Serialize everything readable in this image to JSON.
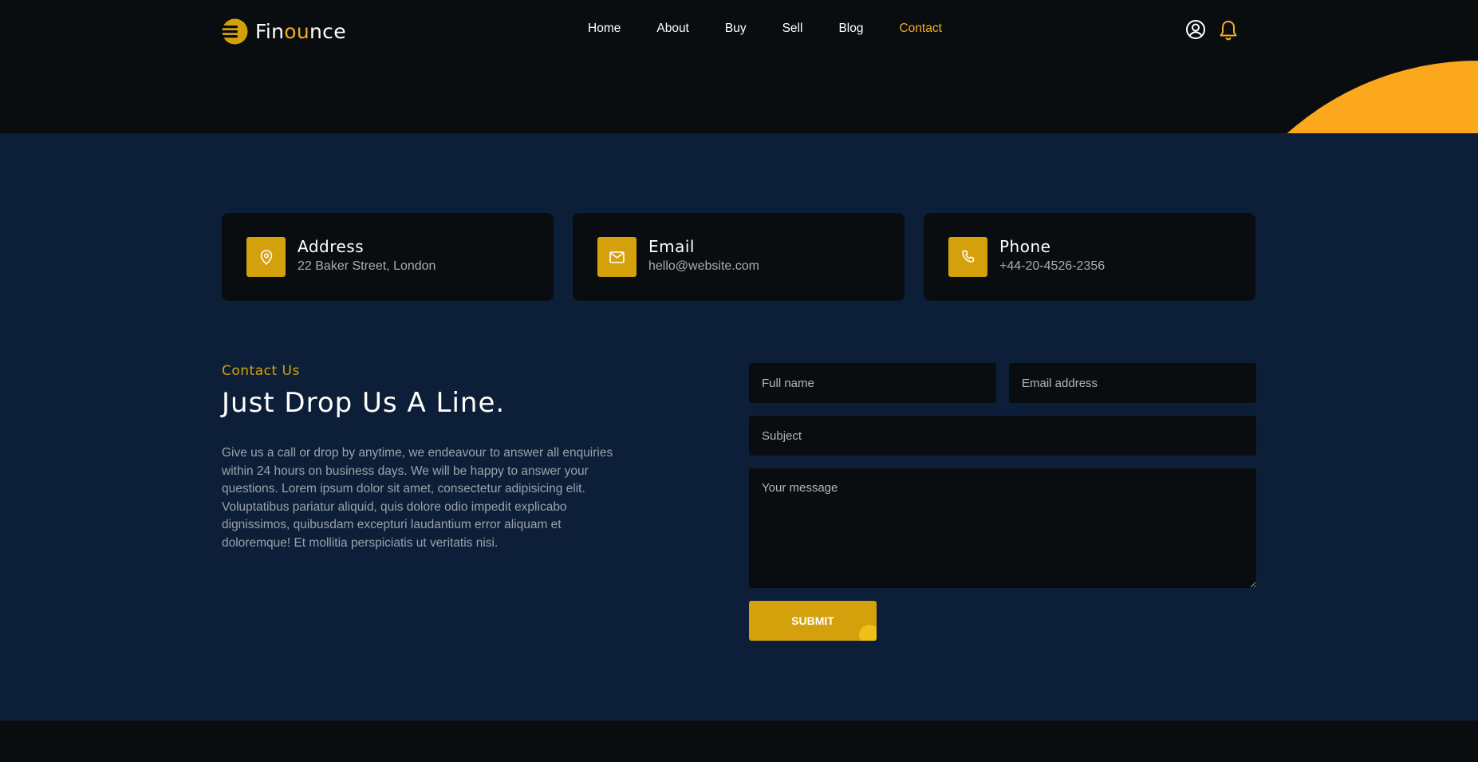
{
  "brand": {
    "name_part1": "Fin",
    "name_accent": "ou",
    "name_part2": "nce",
    "accent_color": "#f3ad1c"
  },
  "nav": {
    "items": [
      {
        "label": "Home",
        "active": false
      },
      {
        "label": "About",
        "active": false
      },
      {
        "label": "Buy",
        "active": false
      },
      {
        "label": "Sell",
        "active": false
      },
      {
        "label": "Blog",
        "active": false
      },
      {
        "label": "Contact",
        "active": true
      }
    ]
  },
  "header_icons": [
    "user-circle-icon",
    "bell-icon"
  ],
  "contact_cards": [
    {
      "icon": "map-pin-icon",
      "title": "Address",
      "value": "22 Baker Street, London"
    },
    {
      "icon": "envelope-icon",
      "title": "Email",
      "value": "hello@website.com"
    },
    {
      "icon": "phone-icon",
      "title": "Phone",
      "value": "+44-20-4526-2356"
    }
  ],
  "section": {
    "eyebrow": "Contact Us",
    "headline": "Just Drop Us A Line.",
    "paragraph": "Give us a call or drop by anytime, we endeavour to answer all enquiries within 24 hours on business days. We will be happy to answer your questions. Lorem ipsum dolor sit amet, consectetur adipisicing elit. Voluptatibus pariatur aliquid, quis dolore odio impedit explicabo dignissimos, quibusdam excepturi laudantium error aliquam et doloremque! Et mollitia perspiciatis ut veritatis nisi."
  },
  "form": {
    "full_name_placeholder": "Full name",
    "email_placeholder": "Email address",
    "subject_placeholder": "Subject",
    "message_placeholder": "Your message",
    "submit_label": "SUBMIT"
  },
  "colors": {
    "primary": "#d4a10d",
    "bg_dark": "#0a0d10",
    "bg_section": "#0d1f38",
    "corner": "#fca81d"
  }
}
